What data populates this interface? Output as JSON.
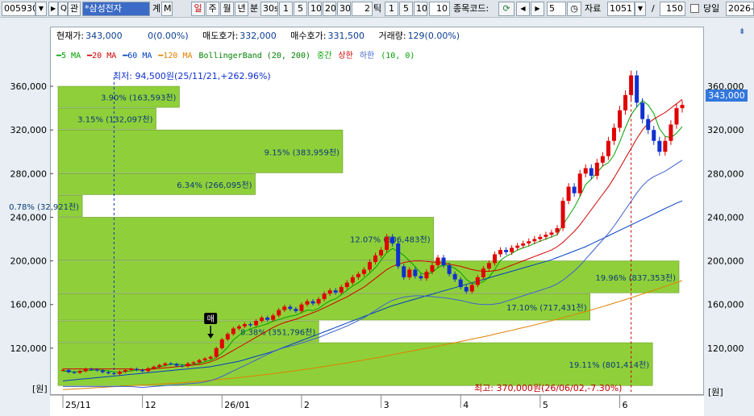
{
  "toolbar": {
    "code": "005930",
    "dropdown_arrow": "▼",
    "play_arrow": "▶",
    "search_label": "Q",
    "interest_label": "관",
    "stock_name": "*삼성전자",
    "stock_suffix": "계",
    "m_label": "M",
    "periods": [
      "일",
      "주",
      "월",
      "년",
      "분"
    ],
    "minute_values": [
      "30s",
      "1",
      "5",
      "10",
      "20",
      "30"
    ],
    "tick_input": "2",
    "tick_label": "틱",
    "tick_values": [
      "1",
      "5",
      "10"
    ],
    "tick_input2": "10",
    "compare_label": "종목코드:",
    "count_value": "5",
    "data_label": "자료",
    "data_count": "1051",
    "slash": "/",
    "total_count": "150",
    "today_label": "당일",
    "date_value": "2026-"
  },
  "info": {
    "current_label": "현재가:",
    "current_value": "343,000",
    "change_value": "0(0.00%)",
    "ask_label": "매도호가:",
    "ask_value": "332,000",
    "bid_label": "매수호가:",
    "bid_value": "331,500",
    "volume_label": "거래량:",
    "volume_value": "129(0.00%)"
  },
  "legend": [
    {
      "text": "5 MA",
      "color": "#00a000"
    },
    {
      "text": "20 MA",
      "color": "#d00000"
    },
    {
      "text": "60 MA",
      "color": "#0040c0"
    },
    {
      "text": "120 MA",
      "color": "#e08000"
    },
    {
      "text": "BollingerBand (20, 200)",
      "color": "#008000"
    },
    {
      "text": "중간",
      "color": "#00a000"
    },
    {
      "text": "상한",
      "color": "#d00000"
    },
    {
      "text": "하한",
      "color": "#4060d0"
    },
    {
      "text": "(10, 0)",
      "color": "#00a000"
    }
  ],
  "colors": {
    "up": "#e00000",
    "down": "#1030d0",
    "volume_profile": "#8fd03a",
    "ma5": "#00a000",
    "ma20": "#d00000",
    "ma60": "#0040c0",
    "ma120": "#e08000",
    "bb_lower": "#4060d0",
    "accent": "#3377dd"
  },
  "unit_label": "[원]",
  "current_price_tag": "343,000",
  "buy_marker": "매",
  "annotations": {
    "low": "최저: 94,500원(25/11/21,+262.96%)",
    "high": "최고: 370,000원(26/06/02,-7.30%)"
  },
  "chart_data": {
    "type": "candlestick",
    "title": "",
    "ylabel": "[원]",
    "ylim": [
      80000,
      380000
    ],
    "y_ticks": [
      "360,000",
      "320,000",
      "280,000",
      "240,000",
      "200,000",
      "160,000",
      "120,000"
    ],
    "x_ticks": [
      "25/11",
      "12",
      "26/01",
      "2",
      "3",
      "4",
      "5",
      "6"
    ],
    "volume_profile": [
      {
        "label": "3.90% (163,593천)",
        "price_range": [
          340000,
          360000
        ],
        "pct": 3.9
      },
      {
        "label": "3.15% (132,097천)",
        "price_range": [
          320000,
          340000
        ],
        "pct": 3.15
      },
      {
        "label": "9.15% (383,959천)",
        "price_range": [
          280000,
          320000
        ],
        "pct": 9.15
      },
      {
        "label": "6.34% (266,095천)",
        "price_range": [
          260000,
          280000
        ],
        "pct": 6.34
      },
      {
        "label": "0.78% (32,921천)",
        "price_range": [
          240000,
          260000
        ],
        "pct": 0.78
      },
      {
        "label": "12.07% (506,483천)",
        "price_range": [
          200000,
          240000
        ],
        "pct": 12.07
      },
      {
        "label": "19.96% (837,353천)",
        "price_range": [
          170000,
          200000
        ],
        "pct": 19.96
      },
      {
        "label": "17.10% (717,431천)",
        "price_range": [
          145000,
          170000
        ],
        "pct": 17.1
      },
      {
        "label": "8.38% (351,796천)",
        "price_range": [
          125000,
          145000
        ],
        "pct": 8.38
      },
      {
        "label": "19.11% (801,414천)",
        "price_range": [
          85000,
          125000
        ],
        "pct": 19.11
      }
    ],
    "close_series": [
      100000,
      98000,
      97500,
      99000,
      101000,
      100500,
      99500,
      98000,
      97000,
      96500,
      98500,
      100000,
      101000,
      100000,
      99000,
      101500,
      103000,
      104500,
      106000,
      105500,
      104000,
      103500,
      106000,
      107000,
      109000,
      110500,
      112000,
      120000,
      128000,
      133000,
      138000,
      140000,
      142000,
      141000,
      145000,
      148000,
      146000,
      150000,
      155000,
      158000,
      156000,
      154000,
      160000,
      163000,
      161000,
      165000,
      170000,
      173000,
      171000,
      176000,
      180000,
      185000,
      188000,
      192000,
      199000,
      205000,
      210000,
      222000,
      216000,
      195000,
      185000,
      192000,
      186000,
      184000,
      190000,
      196000,
      203000,
      196000,
      188000,
      183000,
      176000,
      172000,
      178000,
      185000,
      193000,
      198000,
      206000,
      210000,
      208000,
      212000,
      214000,
      216000,
      218000,
      220000,
      222000,
      224000,
      226000,
      230000,
      255000,
      268000,
      262000,
      280000,
      285000,
      278000,
      290000,
      296000,
      310000,
      322000,
      338000,
      352000,
      370000,
      345000,
      330000,
      320000,
      310000,
      300000,
      310000,
      325000,
      340000,
      343000
    ],
    "series": [
      {
        "name": "5 MA",
        "values": [
          99000,
          98600,
          98300,
          98600,
          99300,
          99800,
          100000,
          99800,
          99200,
          98300,
          98000,
          98500,
          99300,
          100000,
          100100,
          100700,
          101700,
          102800,
          104000,
          105300,
          105400,
          104900,
          104600,
          105100,
          106300,
          107600,
          108900,
          111300,
          115700,
          120700,
          127600,
          131800,
          135200,
          137800,
          139200,
          140800,
          142400,
          144800,
          146200,
          147800,
          149200,
          150200,
          152600,
          155000,
          154400,
          156400,
          160200,
          163400,
          165300,
          169000,
          173000,
          177000,
          180000,
          184200,
          188800,
          193800,
          200600,
          207600,
          211400,
          208600,
          205000,
          200000,
          194800,
          188800,
          187400,
          189600,
          193800,
          196400,
          195600,
          193200,
          189200,
          183000,
          179400,
          178800,
          181000,
          185200,
          192000,
          200400,
          204200,
          206800,
          210000,
          212000,
          213600,
          216000,
          218000,
          220000,
          222000,
          224000,
          233000,
          241000,
          249000,
          259000,
          270000,
          275000,
          281000,
          287000,
          290000,
          297000,
          309000,
          322000,
          334000,
          341000,
          347000,
          343000,
          335000,
          321000,
          314000,
          313000,
          317000,
          323000
        ]
      },
      {
        "name": "20 MA",
        "values": [
          101000,
          101000,
          101000,
          101000,
          101000,
          101000,
          101000,
          101000,
          101000,
          101000,
          101000,
          101000,
          101000,
          100500,
          100000,
          100500,
          101000,
          101500,
          102000,
          102500,
          103000,
          103500,
          104000,
          104500,
          105000,
          106000,
          107500,
          109500,
          112000,
          115000,
          118000,
          121000,
          124000,
          127000,
          130000,
          133000,
          136000,
          139000,
          141500,
          143500,
          145000,
          146500,
          148500,
          150500,
          152500,
          154500,
          157000,
          159500,
          162000,
          164500,
          167000,
          170000,
          173000,
          176000,
          180000,
          184000,
          188000,
          192000,
          195000,
          197000,
          198500,
          199500,
          200000,
          200000,
          199500,
          199000,
          198500,
          198000,
          197000,
          196000,
          195000,
          193500,
          192000,
          191000,
          190500,
          190500,
          191000,
          192000,
          194000,
          196000,
          198000,
          200000,
          202000,
          204000,
          206000,
          208000,
          210000,
          213000,
          217000,
          222000,
          227000,
          233000,
          240000,
          247000,
          254000,
          261000,
          268000,
          276000,
          285000,
          294000,
          303000,
          312000,
          320000,
          326000,
          330000,
          333000,
          336000,
          340000,
          344000,
          348000
        ]
      },
      {
        "name": "60 MA",
        "values": [
          90000,
          90500,
          91000,
          91500,
          92000,
          92500,
          93000,
          93500,
          94000,
          94500,
          95000,
          95500,
          96000,
          96500,
          97000,
          97500,
          98000,
          98500,
          99000,
          99500,
          100000,
          100500,
          101000,
          101500,
          102000,
          102500,
          103000,
          104000,
          105000,
          106000,
          107000,
          108000,
          109500,
          111000,
          112500,
          114000,
          115500,
          117000,
          119000,
          121000,
          123000,
          125000,
          127000,
          129000,
          131000,
          133000,
          135000,
          137000,
          139000,
          141000,
          143000,
          145000,
          147000,
          149000,
          151000,
          153000,
          155000,
          157000,
          159000,
          160500,
          162000,
          163500,
          165000,
          166500,
          168000,
          169500,
          171000,
          172500,
          174000,
          175500,
          177000,
          178500,
          180000,
          181500,
          183000,
          184500,
          186000,
          187500,
          189000,
          190500,
          192000,
          193500,
          195000,
          196500,
          198000,
          199500,
          201000,
          203000,
          205000,
          207000,
          209000,
          211000,
          213000,
          215500,
          218000,
          220500,
          223000,
          225500,
          228000,
          230500,
          233000,
          235500,
          238000,
          240500,
          243000,
          245500,
          248000,
          250500,
          253000,
          255000
        ]
      },
      {
        "name": "120 MA",
        "values": [
          82000,
          82300,
          82600,
          82900,
          83200,
          83500,
          83800,
          84100,
          84400,
          84700,
          85000,
          85300,
          85600,
          85900,
          86200,
          86500,
          86800,
          87100,
          87400,
          87700,
          88000,
          88400,
          88800,
          89200,
          89600,
          90000,
          90500,
          91000,
          91500,
          92000,
          92500,
          93000,
          93600,
          94200,
          94800,
          95400,
          96000,
          96600,
          97300,
          98000,
          98700,
          99400,
          100100,
          100800,
          101600,
          102400,
          103200,
          104000,
          104800,
          105600,
          106500,
          107400,
          108300,
          109200,
          110100,
          111000,
          112000,
          113000,
          114000,
          115000,
          116000,
          117000,
          118000,
          119000,
          120000,
          121000,
          122000,
          123000,
          124000,
          125000,
          126100,
          127200,
          128300,
          129400,
          130500,
          131600,
          132800,
          134000,
          135200,
          136400,
          137600,
          138800,
          140000,
          141300,
          142600,
          143900,
          145200,
          146500,
          147900,
          149300,
          150700,
          152100,
          153600,
          155100,
          156600,
          158100,
          159700,
          161300,
          162900,
          164500,
          166200,
          167900,
          169600,
          171300,
          173000,
          174800,
          176600,
          178400,
          180200,
          182000
        ]
      }
    ]
  }
}
